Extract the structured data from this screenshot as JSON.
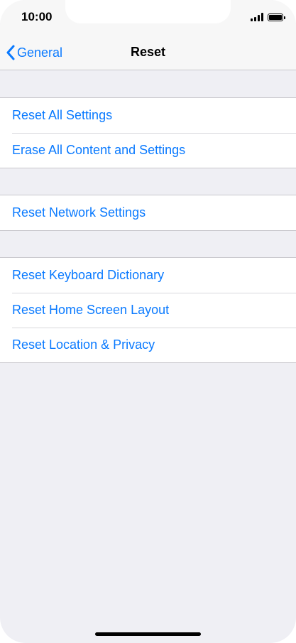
{
  "status_bar": {
    "time": "10:00"
  },
  "nav": {
    "back_label": "General",
    "title": "Reset"
  },
  "groups": [
    {
      "items": [
        {
          "label": "Reset All Settings"
        },
        {
          "label": "Erase All Content and Settings"
        }
      ]
    },
    {
      "items": [
        {
          "label": "Reset Network Settings"
        }
      ]
    },
    {
      "items": [
        {
          "label": "Reset Keyboard Dictionary"
        },
        {
          "label": "Reset Home Screen Layout"
        },
        {
          "label": "Reset Location & Privacy"
        }
      ]
    }
  ],
  "colors": {
    "accent": "#0a7aff",
    "background": "#efeff4",
    "cell": "#ffffff"
  },
  "icons": {
    "back": "chevron-left-icon",
    "signal": "cellular-signal-icon",
    "battery": "battery-icon"
  }
}
